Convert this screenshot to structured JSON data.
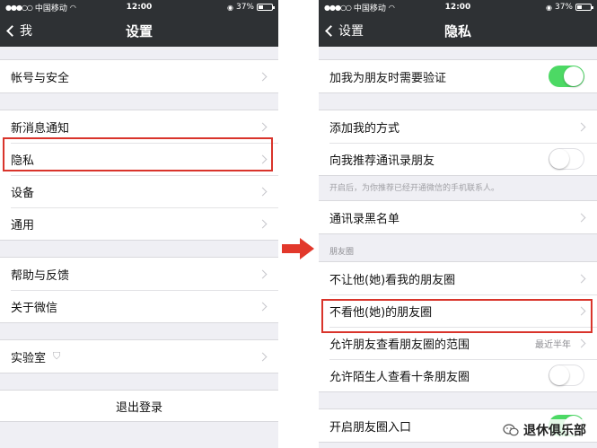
{
  "statusbar": {
    "carrier": "中国移动",
    "time": "12:00",
    "battery": "37%"
  },
  "left": {
    "nav": {
      "back_label": "我",
      "title": "设置"
    },
    "groups": [
      {
        "items": [
          {
            "label": "帐号与安全"
          }
        ]
      },
      {
        "items": [
          {
            "label": "新消息通知"
          },
          {
            "label": "隐私"
          },
          {
            "label": "设备"
          },
          {
            "label": "通用"
          }
        ]
      },
      {
        "items": [
          {
            "label": "帮助与反馈"
          },
          {
            "label": "关于微信"
          }
        ]
      },
      {
        "items": [
          {
            "label": "实验室"
          }
        ]
      }
    ],
    "logout_label": "退出登录"
  },
  "right": {
    "nav": {
      "back_label": "设置",
      "title": "隐私"
    },
    "verify_row": {
      "label": "加我为朋友时需要验证",
      "toggle_on": true
    },
    "add_method_row": {
      "label": "添加我的方式"
    },
    "recommend_row": {
      "label": "向我推荐通讯录朋友",
      "toggle_on": false
    },
    "recommend_footnote": "开启后，为你推荐已经开通微信的手机联系人。",
    "blacklist_row": {
      "label": "通讯录黑名单"
    },
    "moments_header": "朋友圈",
    "moments_rows": [
      {
        "label": "不让他(她)看我的朋友圈"
      },
      {
        "label": "不看他(她)的朋友圈"
      },
      {
        "label": "允许朋友查看朋友圈的范围",
        "value": "最近半年"
      }
    ],
    "stranger_row": {
      "label": "允许陌生人查看十条朋友圈",
      "toggle_on": false
    },
    "moments_entry_row": {
      "label": "开启朋友圈入口",
      "toggle_on": true
    }
  },
  "watermark": {
    "text": "退休俱乐部"
  },
  "colors": {
    "navbar_bg": "#2e3134",
    "toggle_on": "#4cd964",
    "highlight": "#d9342b",
    "arrow": "#e2382b"
  }
}
